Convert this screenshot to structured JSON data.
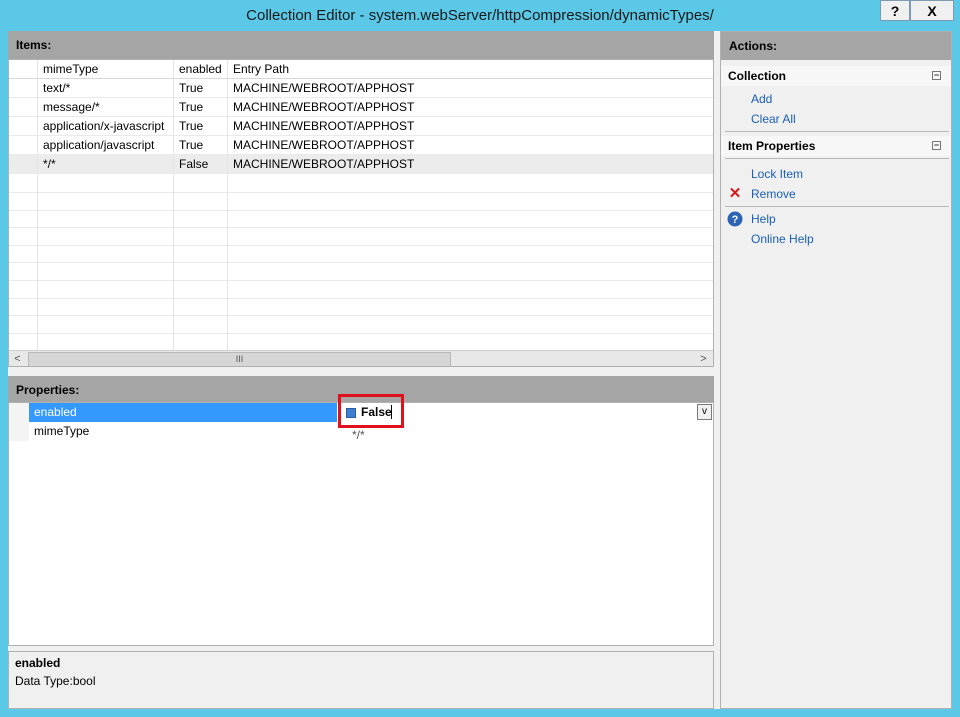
{
  "window": {
    "title": "Collection Editor - system.webServer/httpCompression/dynamicTypes/",
    "help_btn": "?",
    "close_btn": "X"
  },
  "items": {
    "header": "Items:",
    "columns": [
      "mimeType",
      "enabled",
      "Entry Path"
    ],
    "rows": [
      [
        "text/*",
        "True",
        "MACHINE/WEBROOT/APPHOST"
      ],
      [
        "message/*",
        "True",
        "MACHINE/WEBROOT/APPHOST"
      ],
      [
        "application/x-javascript",
        "True",
        "MACHINE/WEBROOT/APPHOST"
      ],
      [
        "application/javascript",
        "True",
        "MACHINE/WEBROOT/APPHOST"
      ],
      [
        "*/*",
        "False",
        "MACHINE/WEBROOT/APPHOST"
      ]
    ],
    "scroll_left": "<",
    "scroll_right": ">",
    "scroll_grip": "III"
  },
  "properties": {
    "header": "Properties:",
    "rows": [
      {
        "name": "enabled",
        "value": "False"
      },
      {
        "name": "mimeType",
        "value": "*/*"
      }
    ],
    "dropdown_glyph": "v"
  },
  "description": {
    "name": "enabled",
    "type": "Data Type:bool"
  },
  "actions": {
    "header": "Actions:",
    "collection_title": "Collection",
    "collapse_glyph": "−",
    "add": "Add",
    "clear_all": "Clear All",
    "item_props_title": "Item Properties",
    "lock_item": "Lock Item",
    "remove": "Remove",
    "help": "Help",
    "online_help": "Online Help"
  },
  "colors": {
    "selection": "#3399ff",
    "link": "#1a5fb4",
    "highlight_box": "#e0101c",
    "titlebar": "#5ac8e6"
  }
}
